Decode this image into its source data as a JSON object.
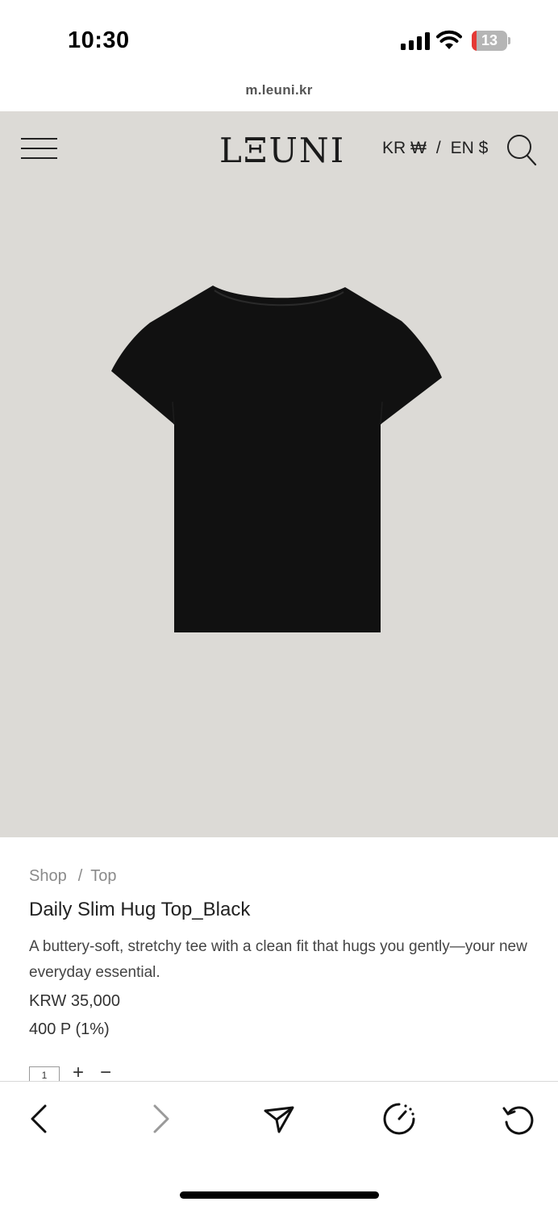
{
  "status_bar": {
    "time": "10:30",
    "battery_level": "13",
    "battery_fraction": 0.13,
    "icons": [
      "signal-icon",
      "wifi-icon",
      "battery-icon"
    ]
  },
  "browser": {
    "url": "m.leuni.kr"
  },
  "header": {
    "logo": "LΞUNI",
    "currency_krw": "KR ₩",
    "currency_sep": "/",
    "currency_en": "EN $",
    "icons": [
      "menu-icon",
      "search-icon"
    ]
  },
  "product": {
    "image_alt_icon": "black-tshirt-image",
    "breadcrumb": {
      "shop": "Shop",
      "sep": "/",
      "category": "Top"
    },
    "title": "Daily Slim Hug Top_Black",
    "description": "A buttery-soft, stretchy tee with a clean fit that hugs you gently—your new everyday essential.",
    "price": "KRW 35,000",
    "points": "400 P (1%)",
    "quantity": "1",
    "qty_plus": "+",
    "qty_minus": "−"
  },
  "toolbar": {
    "icons": [
      "back-icon",
      "forward-icon",
      "share-icon",
      "timer-icon",
      "reload-icon"
    ]
  },
  "colors": {
    "site_background": "#dcdad6",
    "product": "#111111",
    "battery_low": "#e53935"
  }
}
